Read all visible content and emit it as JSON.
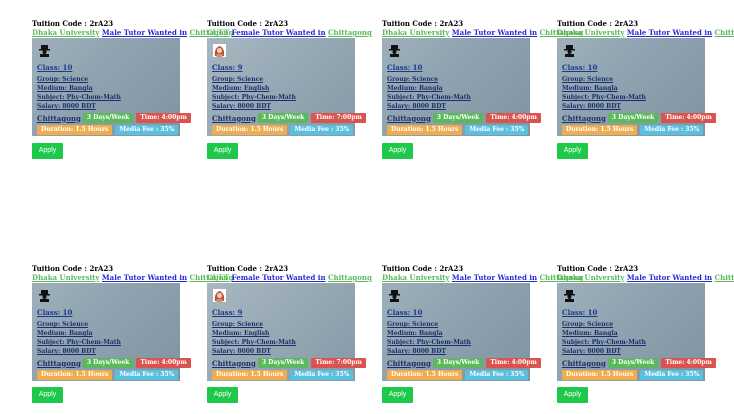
{
  "colors": {
    "apply_button": "#1ec84a",
    "days_badge": "#5cb85c",
    "time_badge": "#d9534f",
    "duration_badge": "#f0ad4e",
    "fee_badge": "#5bc0de",
    "university_link": "#5cb85c",
    "tutor_link": "#2a2ad0"
  },
  "cards": [
    {
      "code": "Tuition Code : 2rA23",
      "university": "Dhaka University",
      "tutor_wanted": "Male Tutor Wanted in",
      "location": "Chittagong",
      "avatar_icon": "male-avatar-icon",
      "class": "Class: 10",
      "group": "Group: Science",
      "medium": "Medium: Bangla",
      "subject": "Subject: Phy-Chem-Math",
      "salary": "Salary: 8000 BDT",
      "city": "Chittagong",
      "days": "3 Days/Week",
      "time": "Time: 4:00pm",
      "duration": "Duration: 1.5 Hours",
      "media_fee": "Media Fee : 35%",
      "apply": "Apply"
    },
    {
      "code": "Tuition Code : 2rA23",
      "university": "CUET",
      "tutor_wanted": "Female Tutor Wanted in",
      "location": "Chittagong",
      "avatar_icon": "female-avatar-icon",
      "class": "Class: 9",
      "group": "Group: Science",
      "medium": "Medium: English",
      "subject": "Subject: Phy-Chem-Math",
      "salary": "Salary: 8000 BDT",
      "city": "Chittagong",
      "days": "3 Days/Week",
      "time": "Time: 7:00pm",
      "duration": "Duration: 1.5 Hours",
      "media_fee": "Media Fee : 35%",
      "apply": "Apply"
    },
    {
      "code": "Tuition Code : 2rA23",
      "university": "Dhaka University",
      "tutor_wanted": "Male Tutor Wanted in",
      "location": "Chittagong",
      "avatar_icon": "male-avatar-icon",
      "class": "Class: 10",
      "group": "Group: Science",
      "medium": "Medium: Bangla",
      "subject": "Subject: Phy-Chem-Math",
      "salary": "Salary: 8000 BDT",
      "city": "Chittagong",
      "days": "3 Days/Week",
      "time": "Time: 4:00pm",
      "duration": "Duration: 1.5 Hours",
      "media_fee": "Media Fee : 35%",
      "apply": "Apply"
    },
    {
      "code": "Tuition Code : 2rA23",
      "university": "Dhaka University",
      "tutor_wanted": "Male Tutor Wanted in",
      "location": "Chittagong",
      "avatar_icon": "male-avatar-icon",
      "class": "Class: 10",
      "group": "Group: Science",
      "medium": "Medium: Bangla",
      "subject": "Subject: Phy-Chem-Math",
      "salary": "Salary: 8000 BDT",
      "city": "Chittagong",
      "days": "3 Days/Week",
      "time": "Time: 4:00pm",
      "duration": "Duration: 1.5 Hours",
      "media_fee": "Media Fee : 35%",
      "apply": "Apply"
    },
    {
      "code": "Tuition Code : 2rA23",
      "university": "Dhaka University",
      "tutor_wanted": "Male Tutor Wanted in",
      "location": "Chittagong",
      "avatar_icon": "male-avatar-icon",
      "class": "Class: 10",
      "group": "Group: Science",
      "medium": "Medium: Bangla",
      "subject": "Subject: Phy-Chem-Math",
      "salary": "Salary: 8000 BDT",
      "city": "Chittagong",
      "days": "3 Days/Week",
      "time": "Time: 4:00pm",
      "duration": "Duration: 1.5 Hours",
      "media_fee": "Media Fee : 35%",
      "apply": "Apply"
    },
    {
      "code": "Tuition Code : 2rA23",
      "university": "CUET",
      "tutor_wanted": "Female Tutor Wanted in",
      "location": "Chittagong",
      "avatar_icon": "female-avatar-icon",
      "class": "Class: 9",
      "group": "Group: Science",
      "medium": "Medium: English",
      "subject": "Subject: Phy-Chem-Math",
      "salary": "Salary: 8000 BDT",
      "city": "Chittagong",
      "days": "3 Days/Week",
      "time": "Time: 7:00pm",
      "duration": "Duration: 1.5 Hours",
      "media_fee": "Media Fee : 35%",
      "apply": "Apply"
    },
    {
      "code": "Tuition Code : 2rA23",
      "university": "Dhaka University",
      "tutor_wanted": "Male Tutor Wanted in",
      "location": "Chittagong",
      "avatar_icon": "male-avatar-icon",
      "class": "Class: 10",
      "group": "Group: Science",
      "medium": "Medium: Bangla",
      "subject": "Subject: Phy-Chem-Math",
      "salary": "Salary: 8000 BDT",
      "city": "Chittagong",
      "days": "3 Days/Week",
      "time": "Time: 4:00pm",
      "duration": "Duration: 1.5 Hours",
      "media_fee": "Media Fee : 35%",
      "apply": "Apply"
    },
    {
      "code": "Tuition Code : 2rA23",
      "university": "Dhaka University",
      "tutor_wanted": "Male Tutor Wanted in",
      "location": "Chittagong",
      "avatar_icon": "male-avatar-icon",
      "class": "Class: 10",
      "group": "Group: Science",
      "medium": "Medium: Bangla",
      "subject": "Subject: Phy-Chem-Math",
      "salary": "Salary: 8000 BDT",
      "city": "Chittagong",
      "days": "3 Days/Week",
      "time": "Time: 4:00pm",
      "duration": "Duration: 1.5 Hours",
      "media_fee": "Media Fee : 35%",
      "apply": "Apply"
    }
  ]
}
